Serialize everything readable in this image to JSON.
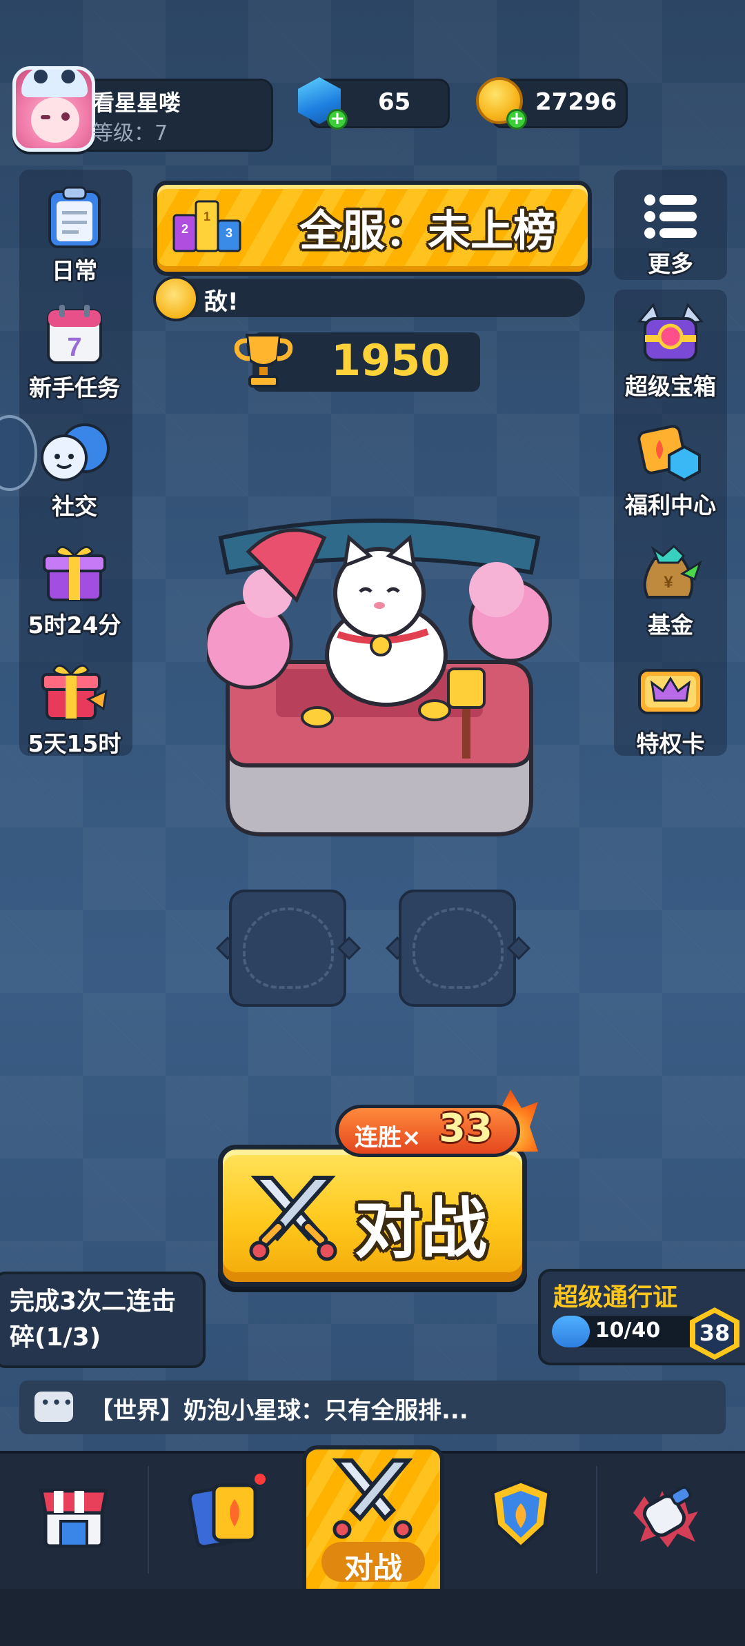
{
  "player": {
    "name": "看星星喽",
    "level_label": "等级：7"
  },
  "currency": {
    "gems": "65",
    "coins": "27296"
  },
  "rank": {
    "text": "全服：未上榜"
  },
  "announcement": {
    "text": "敌!"
  },
  "trophies": "1950",
  "left_menu": [
    {
      "label": "日常",
      "icon": "clipboard-icon"
    },
    {
      "label": "新手任务",
      "icon": "calendar-icon"
    },
    {
      "label": "社交",
      "icon": "chat-bubbles-icon"
    },
    {
      "label": "5时24分",
      "icon": "gift-icon"
    },
    {
      "label": "5天15时",
      "icon": "gift-party-icon"
    }
  ],
  "right_menu": [
    {
      "label": "更多",
      "icon": "menu-icon"
    },
    {
      "label": "超级宝箱",
      "icon": "treasure-chest-icon"
    },
    {
      "label": "福利中心",
      "icon": "welfare-icon"
    },
    {
      "label": "基金",
      "icon": "money-bag-icon"
    },
    {
      "label": "特权卡",
      "icon": "crown-card-icon"
    }
  ],
  "battle": {
    "label": "对战",
    "streak_label": "连胜×",
    "streak_count": "33"
  },
  "mission": {
    "text": "完成3次二连击碎(1/3)"
  },
  "pass": {
    "title": "超级通行证",
    "progress_text": "10/40",
    "current": 10,
    "max": 40,
    "level": "38"
  },
  "chat": {
    "text": "【世界】奶泡小星球：只有全服排..."
  },
  "bottom_nav": {
    "active_label": "对战"
  },
  "colors": {
    "accent_yellow": "#ffc21f",
    "trophy_gold": "#ffd23a",
    "pass_blue": "#2f7fe0",
    "background": "#35557a"
  }
}
